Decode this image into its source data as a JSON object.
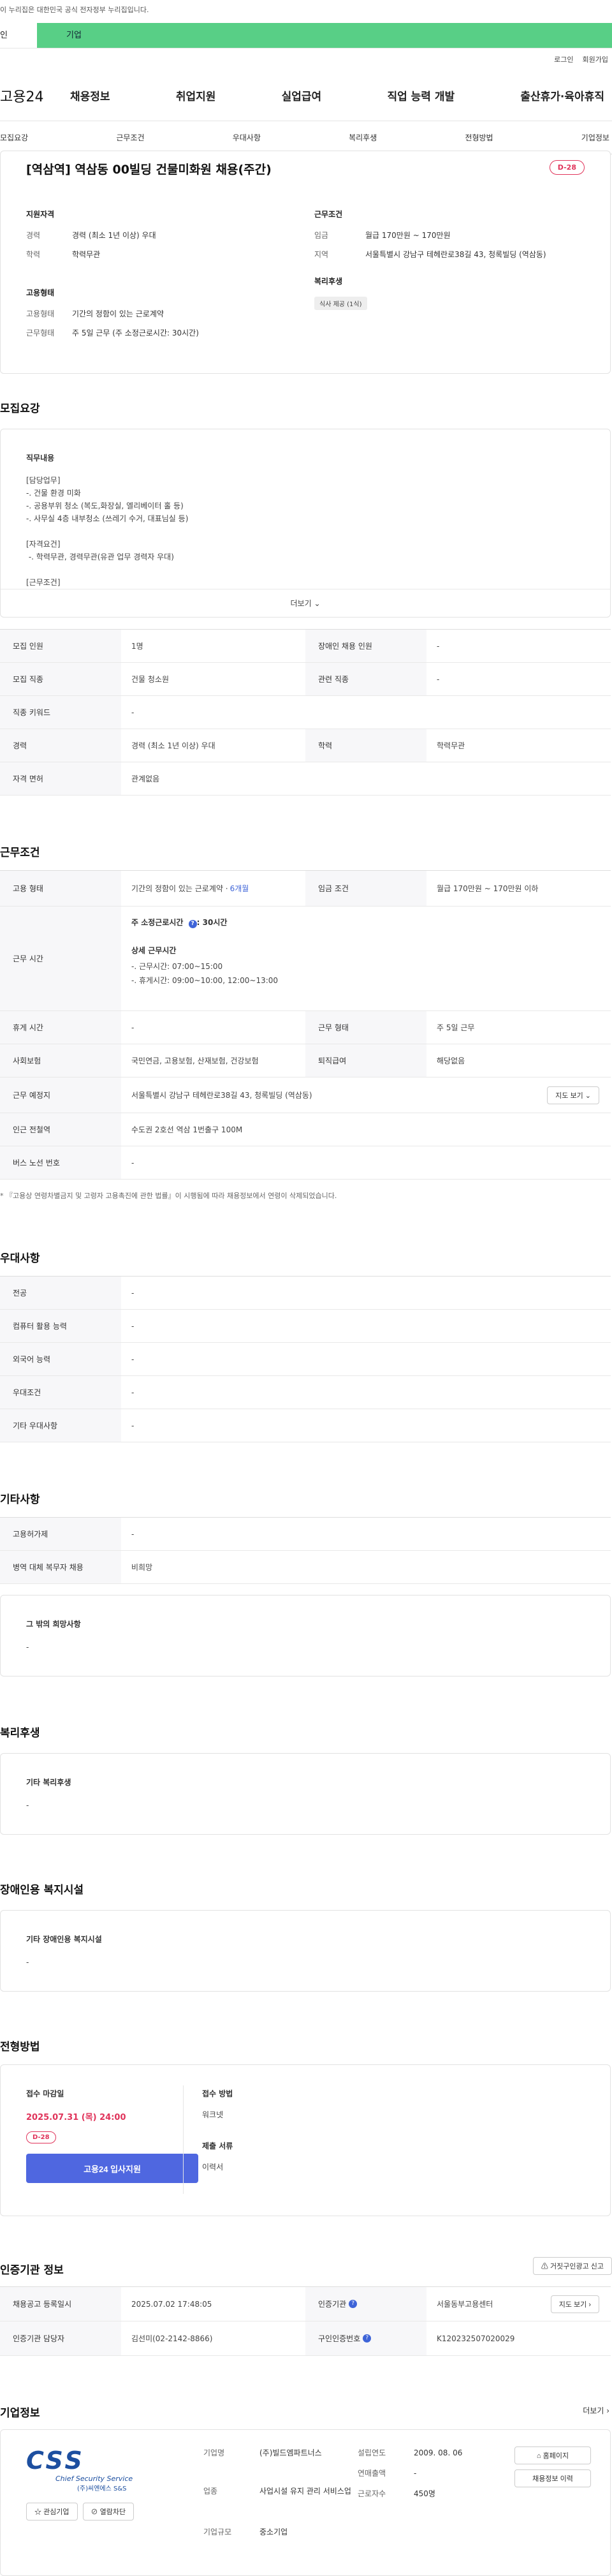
{
  "gov_notice": "이 누리집은 대한민국 공식 전자정부 누리집입니다.",
  "top_tabs": [
    "인",
    "기업"
  ],
  "util": {
    "login": "로그인",
    "join": "회원가입"
  },
  "logo": "고용24",
  "gnb": [
    "채용정보",
    "취업지원",
    "실업급여",
    "직업 능력 개발",
    "출산휴가·육아휴직"
  ],
  "subnav": [
    "모집요강",
    "근무조건",
    "우대사항",
    "복리후생",
    "전형방법",
    "기업정보"
  ],
  "job": {
    "title": "[역삼역] 역삼동 00빌딩 건물미화원 채용(주간)",
    "dday": "D-28"
  },
  "summary": {
    "qual_title": "지원자격",
    "qual": [
      {
        "k": "경력",
        "v": "경력 (최소 1년 이상) 우대"
      },
      {
        "k": "학력",
        "v": "학력무관"
      }
    ],
    "emp_title": "고용형태",
    "emp": [
      {
        "k": "고용형태",
        "v": "기간의 정함이 있는 근로계약"
      },
      {
        "k": "근무형태",
        "v": "주 5일 근무 (주 소정근로시간: 30시간)"
      }
    ],
    "cond_title": "근무조건",
    "cond": [
      {
        "k": "임금",
        "v": "월급 170만원 ~ 170만원"
      },
      {
        "k": "지역",
        "v": "서울특별시 강남구 테헤란로38길 43, 청록빌딩 (역삼동)"
      }
    ],
    "welfare_title": "복리후생",
    "welfare_chip": "식사 제공 (1식)"
  },
  "recruit": {
    "title": "모집요강",
    "duty_label": "직무내용",
    "duty_text": "[담당업무]\n-. 건물 환경 미화\n-. 공용부위 청소 (복도,화장실, 엘리베이터 홀 등)\n-. 사무실 4층 내부청소 (쓰레기 수거, 대표님실 등)\n\n[자격요건]\n -. 학력무관, 경력무관(유관 업무 경력자 우대)\n\n[근무조건]",
    "more": "더보기",
    "rows": [
      {
        "k1": "모집 인원",
        "v1": "1명",
        "k2": "장애인 채용 인원",
        "v2": "-"
      },
      {
        "k1": "모집 직종",
        "v1": "건물 청소원",
        "k2": "관련 직종",
        "v2": "-"
      },
      {
        "k1": "직종 키워드",
        "v1": "-"
      },
      {
        "k1": "경력",
        "v1": "경력 (최소 1년 이상) 우대",
        "k2": "학력",
        "v2": "학력무관"
      },
      {
        "k1": "자격 면허",
        "v1": "관계없음"
      }
    ]
  },
  "work": {
    "title": "근무조건",
    "emp_k": "고용 형태",
    "emp_v": "기간의 정함이 있는 근로계약 · ",
    "emp_link": "6개월",
    "pay_k": "임금 조건",
    "pay_v": "월급 170만원 ~ 170만원 이하",
    "hours_k": "근무 시간",
    "hours_weekly": "주 소정근로시간",
    "hours_weekly_v": ": 30시간",
    "hours_detail_label": "상세 근무시간",
    "hours_detail": "-. 근무시간: 07:00~15:00\n-. 휴게시간: 09:00~10:00, 12:00~13:00",
    "holiday_k": "휴게 시간",
    "holiday_v": "-",
    "form_k": "근무 형태",
    "form_v": "주 5일 근무",
    "ins_k": "사회보험",
    "ins_v": "국민연금, 고용보험, 산재보험, 건강보험",
    "ret_k": "퇴직급여",
    "ret_v": "해당없음",
    "place_k": "근무 예정지",
    "place_v": "서울특별시 강남구 테헤란로38길 43, 청록빌딩 (역삼동)",
    "map_btn": "지도 보기",
    "sub_k": "인근 전철역",
    "sub_v": "수도권 2호선 역삼 1번출구 100M",
    "bus_k": "버스 노선 번호",
    "bus_v": "-",
    "note": "* 『고용상 연령차별금지 및 고령자 고용촉진에 관한 법률』이 시행됨에 따라 채용정보에서 연령이 삭제되었습니다."
  },
  "pref": {
    "title": "우대사항",
    "rows": [
      {
        "k": "전공",
        "v": "-"
      },
      {
        "k": "컴퓨터 활용 능력",
        "v": "-"
      },
      {
        "k": "외국어 능력",
        "v": "-"
      },
      {
        "k": "우대조건",
        "v": "-"
      },
      {
        "k": "기타 우대사항",
        "v": "-"
      }
    ]
  },
  "etc": {
    "title": "기타사항",
    "rows": [
      {
        "k": "고용허가제",
        "v": "-"
      },
      {
        "k": "병역 대체 복무자 채용",
        "v": "비희망"
      }
    ],
    "hope_label": "그 밖의 희망사항",
    "hope_v": "-"
  },
  "welfare": {
    "title": "복리후생",
    "label": "기타 복리후생",
    "v": "-"
  },
  "disabled": {
    "title": "장애인용 복지시설",
    "label": "기타 장애인용 복지시설",
    "v": "-"
  },
  "apply": {
    "title": "전형방법",
    "deadline_label": "접수 마감일",
    "deadline": "2025.07.31 (목) 24:00",
    "dday": "D-28",
    "btn": "고용24 입사지원",
    "method_label": "접수 방법",
    "method": "워크넷",
    "docs_label": "제출 서류",
    "docs": "이력서"
  },
  "agency": {
    "title": "인증기관 정보",
    "report_btn": "거짓구인광고 신고",
    "reg_k": "채용공고 등록일시",
    "reg_v": "2025.07.02 17:48:05",
    "org_k": "인증기관",
    "org_v": "서울동부고용센터",
    "map_btn": "지도 보기",
    "mgr_k": "인증기관 담당자",
    "mgr_v": "김선미(02-2142-8866)",
    "no_k": "구인인증번호",
    "no_v": "K120232507020029"
  },
  "company": {
    "title": "기업정보",
    "more": "더보기",
    "logo_text": "CSS",
    "logo_sub": "Chief Security Service",
    "logo_kr": "(주)씨엔에스 S&S",
    "fav_btn": "관심기업",
    "block_btn": "열람차단",
    "name_k": "기업명",
    "name_v": "(주)빌드엠파트너스",
    "found_k": "설립연도",
    "found_v": "2009. 08. 06",
    "ind_k": "업종",
    "ind_v": "사업시설 유지 관리 서비스업",
    "rev_k": "연매출액",
    "rev_v": "-",
    "emp_k": "근로자수",
    "emp_v": "450명",
    "size_k": "기업규모",
    "size_v": "중소기업",
    "home_btn": "홈페이지",
    "jobs_btn": "채용정보 이력"
  }
}
